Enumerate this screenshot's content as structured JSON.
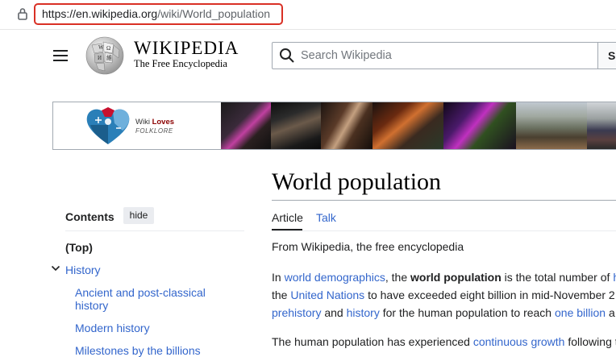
{
  "browser": {
    "url_host": "https://en.wikipedia.org",
    "url_path": "/wiki/World_population"
  },
  "header": {
    "wordmark": "WIKIPEDIA",
    "tagline": "The Free Encyclopedia",
    "search_placeholder": "Search Wikipedia",
    "search_button": "S"
  },
  "banner": {
    "wiki_loves_1": "Wiki ",
    "wiki_loves_2": "Loves",
    "folklore": "FOLKLORE"
  },
  "toc": {
    "title": "Contents",
    "hide_label": "hide",
    "top_label": "(Top)",
    "items": [
      "History",
      "Ancient and post-classical history",
      "Modern history",
      "Milestones by the billions"
    ]
  },
  "article": {
    "title": "World population",
    "tab_article": "Article",
    "tab_talk": "Talk",
    "from_wikipedia": "From Wikipedia, the free encyclopedia",
    "p1_l1_a": "In ",
    "p1_l1_link1": "world demographics",
    "p1_l1_b": ", the ",
    "p1_l1_bold": "world population",
    "p1_l1_c": " is the total number of ",
    "p1_l1_link2": "h",
    "p1_l2_a": "the ",
    "p1_l2_link": "United Nations",
    "p1_l2_b": " to have exceeded eight billion in mid-November 2",
    "p1_l3_link1": "prehistory",
    "p1_l3_a": " and ",
    "p1_l3_link2": "history",
    "p1_l3_b": " for the human population to reach ",
    "p1_l3_link3": "one billion",
    "p1_l3_c": " a",
    "p2_l1_a": "The human population has experienced ",
    "p2_l1_link": "continuous growth",
    "p2_l1_b": " following t"
  },
  "colors": {
    "link": "#3366cc",
    "url_highlight": "#d93025"
  }
}
